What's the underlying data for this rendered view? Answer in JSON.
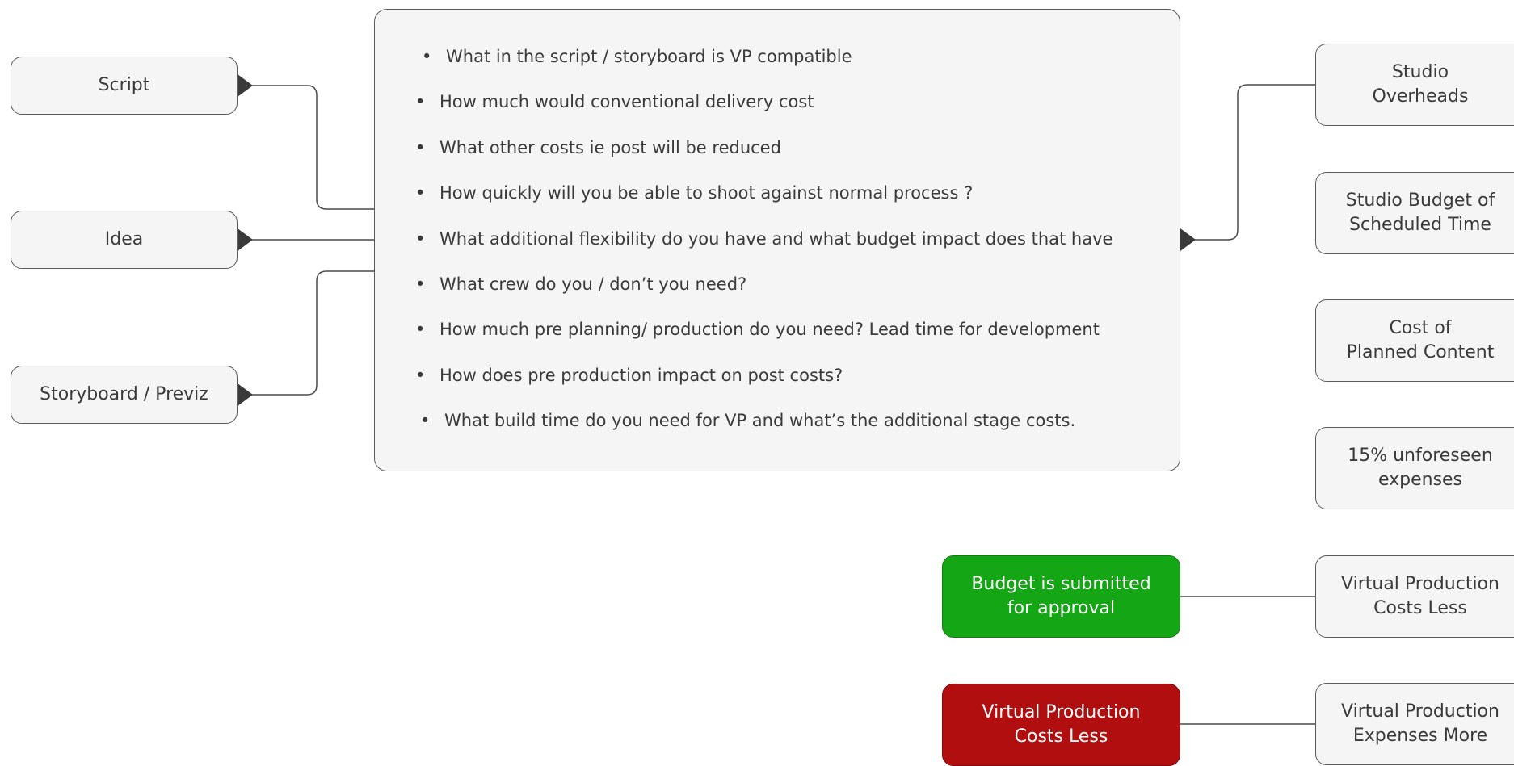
{
  "inputs": [
    {
      "label": [
        "Script"
      ]
    },
    {
      "label": [
        "Idea"
      ]
    },
    {
      "label": [
        "Storyboard / Previz"
      ]
    }
  ],
  "questions": [
    "What in the script / storyboard is VP compatible",
    "How much would conventional delivery cost",
    "What other costs ie post will be reduced",
    "How quickly will you be able to shoot against normal process ?",
    "What additional flexibility do you have and what budget impact does that have",
    "What crew do you / don’t you need?",
    "How much pre planning/ production do you need? Lead time for development",
    "How does pre production impact on post costs?",
    "What build time do you need for VP and what’s the additional stage costs."
  ],
  "bullet": "•",
  "outputs": [
    {
      "label": [
        "Studio",
        "Overheads"
      ]
    },
    {
      "label": [
        "Studio Budget of",
        "Scheduled Time"
      ]
    },
    {
      "label": [
        "Cost of",
        "Planned Content"
      ]
    },
    {
      "label": [
        "15% unforeseen",
        "expenses"
      ]
    },
    {
      "label": [
        "Virtual Production",
        "Costs Less"
      ]
    },
    {
      "label": [
        "Virtual Production",
        "Expenses More"
      ]
    }
  ],
  "approval": {
    "label": [
      "Budget is submitted",
      "for approval"
    ],
    "color": "#15a616"
  },
  "vp_less_red": {
    "label": [
      "Virtual Production",
      "Costs Less"
    ],
    "color": "#b10f0f"
  },
  "colors": {
    "line": "#4a4a4a",
    "box_fill": "#f5f5f5",
    "box_border": "#5a5a5a"
  }
}
